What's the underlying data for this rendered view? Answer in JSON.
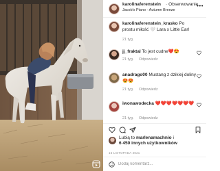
{
  "post": {
    "author": "karolinaferenstein",
    "follow_label": "Obserwowanie",
    "audio": "Jacob's Piano · Autumn Breeze"
  },
  "comments": [
    {
      "username": "karolinaferenstein_krasko",
      "text": "Po prostu miłość 🤍 Lara x Little Earl",
      "time": "21 tyg.",
      "reply": ""
    },
    {
      "username": "jj_fraktal",
      "text": "To jest cudne❤️😍",
      "time": "21 tyg.",
      "reply": "Odpowiedz"
    },
    {
      "username": "anadrago00",
      "text": "Mustang z dzikiej doliny 😍😍",
      "time": "21 tyg.",
      "reply": "Odpowiedz"
    },
    {
      "username": "iwonawodecka",
      "text": "❤️❤️❤️❤️❤️❤️❤️",
      "time": "21 tyg.",
      "reply": "Odpowiedz"
    }
  ],
  "likes": {
    "prefix": "Lubią to",
    "user": "marlenamachnio",
    "and": "i",
    "others": "6 450 innych użytkowników"
  },
  "date": "16 LISTOPADA 2021",
  "add_comment": {
    "placeholder": "Dodaj komentarz..."
  },
  "colors": {
    "text": "#262626",
    "muted": "#8e8e8e",
    "divider": "#efefef",
    "background": "#ffffff"
  },
  "icons": [
    "reel-icon",
    "more-icon",
    "heart-icon",
    "comment-icon",
    "share-icon",
    "bookmark-icon",
    "emoji-icon"
  ]
}
